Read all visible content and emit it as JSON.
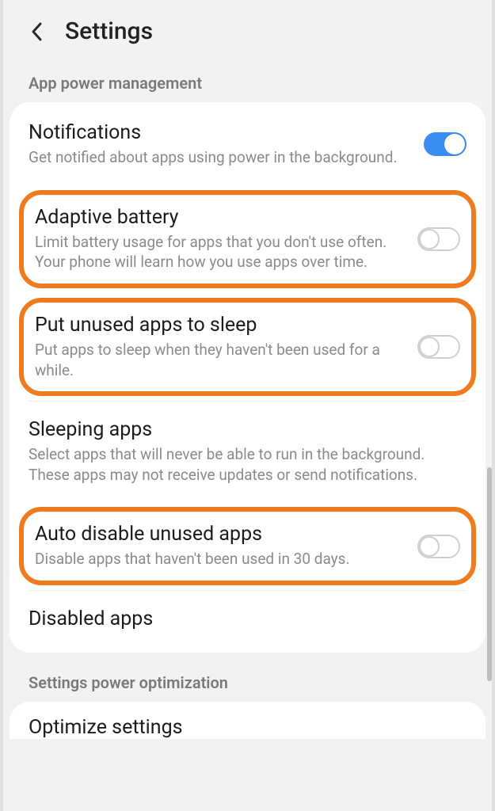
{
  "header": {
    "title": "Settings"
  },
  "section1": {
    "label": "App power management"
  },
  "rows": {
    "notifications": {
      "title": "Notifications",
      "desc": "Get notified about apps using power in the background.",
      "on": true
    },
    "adaptive": {
      "title": "Adaptive battery",
      "desc": "Limit battery usage for apps that you don't use often. Your phone will learn how you use apps over time.",
      "on": false
    },
    "sleep_unused": {
      "title": "Put unused apps to sleep",
      "desc": "Put apps to sleep when they haven't been used for a while.",
      "on": false
    },
    "sleeping_apps": {
      "title": "Sleeping apps",
      "desc": "Select apps that will never be able to run in the background. These apps may not receive updates or send notifications."
    },
    "auto_disable": {
      "title": "Auto disable unused apps",
      "desc": "Disable apps that haven't been used in 30 days.",
      "on": false
    },
    "disabled_apps": {
      "title": "Disabled apps"
    }
  },
  "section2": {
    "label": "Settings power optimization"
  },
  "optimize": {
    "title": "Optimize settings"
  },
  "colors": {
    "highlight": "#ee7b1f",
    "toggle_on": "#3b8df0"
  }
}
